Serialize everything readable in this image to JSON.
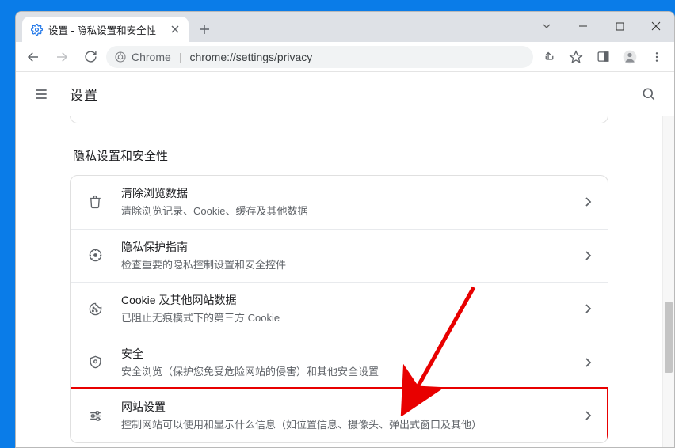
{
  "window": {
    "tab_title": "设置 - 隐私设置和安全性"
  },
  "address": {
    "chrome_label": "Chrome",
    "url": "chrome://settings/privacy"
  },
  "appbar": {
    "title": "设置"
  },
  "section": {
    "title": "隐私设置和安全性"
  },
  "rows": [
    {
      "icon": "trash-icon",
      "title": "清除浏览数据",
      "desc": "清除浏览记录、Cookie、缓存及其他数据"
    },
    {
      "icon": "guide-icon",
      "title": "隐私保护指南",
      "desc": "检查重要的隐私控制设置和安全控件"
    },
    {
      "icon": "cookie-icon",
      "title": "Cookie 及其他网站数据",
      "desc": "已阻止无痕模式下的第三方 Cookie"
    },
    {
      "icon": "shield-icon",
      "title": "安全",
      "desc": "安全浏览（保护您免受危险网站的侵害）和其他安全设置"
    },
    {
      "icon": "tune-icon",
      "title": "网站设置",
      "desc": "控制网站可以使用和显示什么信息（如位置信息、摄像头、弹出式窗口及其他）"
    }
  ],
  "annotation": {
    "arrow_color": "#e80000"
  }
}
